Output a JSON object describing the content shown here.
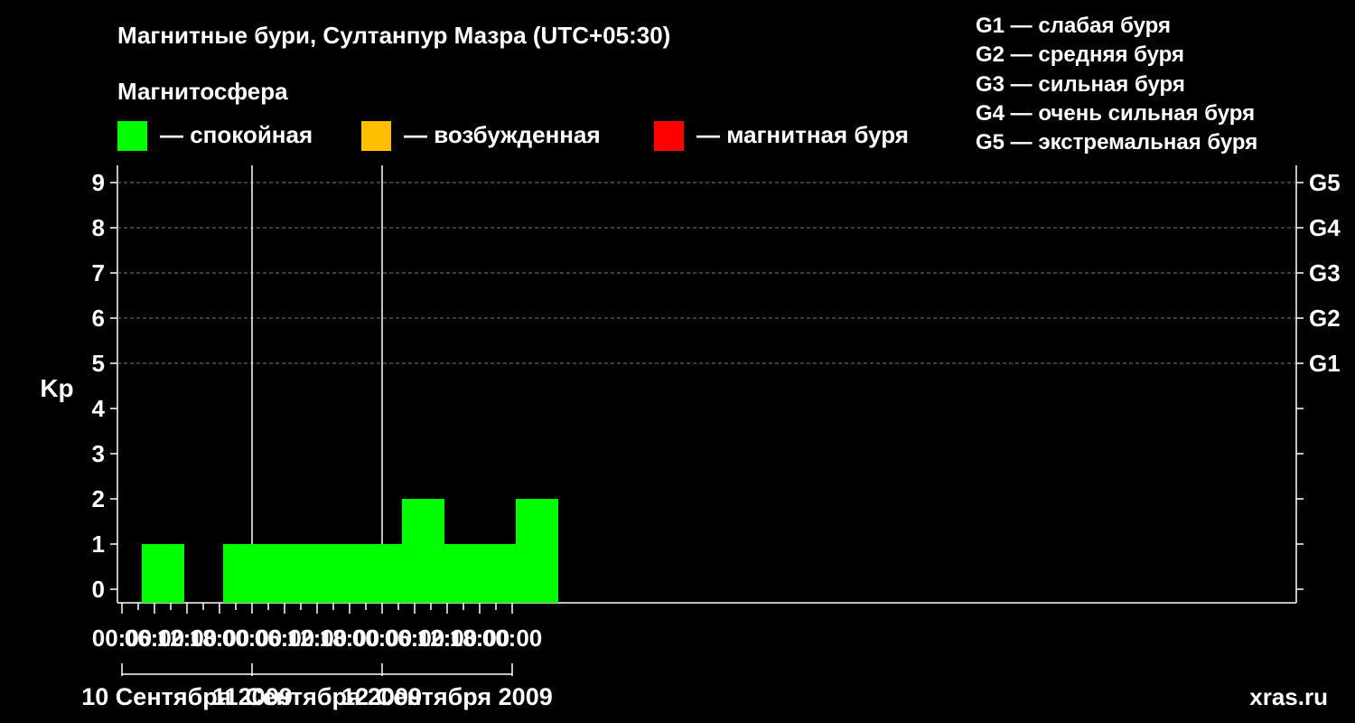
{
  "title": "Магнитные бури, Султанпур Мазра (UTC+05:30)",
  "subtitle": "Магнитосфера",
  "legend": [
    {
      "label": "— спокойная",
      "color": "#00ff00"
    },
    {
      "label": "— возбужденная",
      "color": "#ffbf00"
    },
    {
      "label": "— магнитная буря",
      "color": "#ff0000"
    }
  ],
  "g_scale": [
    "G1 — слабая буря",
    "G2 — средняя буря",
    "G3 — сильная буря",
    "G4 — очень сильная буря",
    "G5 — экстремальная буря"
  ],
  "watermark": "xras.ru",
  "chart_data": {
    "type": "bar",
    "ylabel": "Kp",
    "ylim": [
      0,
      9
    ],
    "y_ticks": [
      "0",
      "1",
      "2",
      "3",
      "4",
      "5",
      "6",
      "7",
      "8",
      "9"
    ],
    "right_labels": [
      {
        "value": 5,
        "label": "G1"
      },
      {
        "value": 6,
        "label": "G2"
      },
      {
        "value": 7,
        "label": "G3"
      },
      {
        "value": 8,
        "label": "G4"
      },
      {
        "value": 9,
        "label": "G5"
      }
    ],
    "x_ticks": [
      "00:00",
      "06:00",
      "12:00",
      "18:00",
      "00:00",
      "06:00",
      "12:00",
      "18:00",
      "00:00",
      "06:00",
      "12:00",
      "18:00",
      "00:00"
    ],
    "days": [
      "10 Сентября 2009",
      "11 Сентября 2009",
      "12 Сентября 2009"
    ],
    "grid": "dashed horizontal at Kp 5-9",
    "series": [
      {
        "color": "#00ff00",
        "interval_hours": 3,
        "values": [
          0,
          1,
          0,
          0,
          0,
          0,
          1,
          1,
          1,
          1,
          0,
          1,
          1,
          1,
          1,
          1,
          1,
          2,
          0,
          1,
          1,
          1,
          1,
          1,
          2
        ]
      }
    ]
  }
}
